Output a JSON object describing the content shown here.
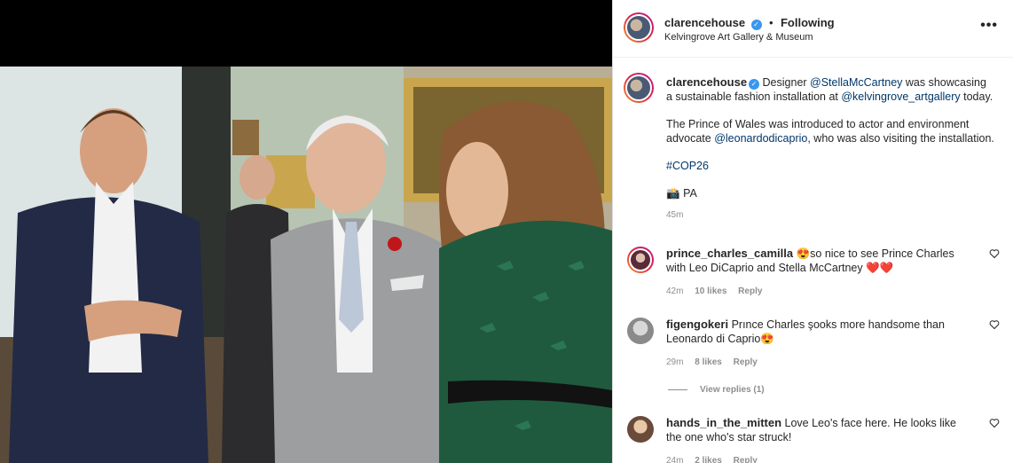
{
  "post": {
    "username": "clarencehouse",
    "verified_mark": "✓",
    "separator": "•",
    "follow_label": "Following",
    "location": "Kelvingrove Art Gallery & Museum",
    "more_icon": "•••"
  },
  "caption": {
    "username": "clarencehouse",
    "line1_pre": "Designer ",
    "mention1": "@StellaMcCartney",
    "line1_mid": " was showcasing a sustainable fashion installation at ",
    "mention2": "@kelvingrove_artgallery",
    "line1_post": " today.",
    "line2_pre": "The Prince of Wales was introduced to actor and environment advocate ",
    "mention3": "@leonardodicaprio",
    "line2_post": ", who was also visiting the installation.",
    "hashtag": "#COP26",
    "credit_icon": "📸",
    "credit": "PA",
    "time": "45m"
  },
  "comments": [
    {
      "username": "prince_charles_camilla",
      "text": "😍so nice to see Prince Charles with Leo DiCaprio and Stella McCartney ❤️❤️",
      "time": "42m",
      "likes": "10 likes",
      "reply": "Reply"
    },
    {
      "username": "figengokeri",
      "text": "Prınce Charles şooks more handsome than Leonardo di Caprio😍",
      "time": "29m",
      "likes": "8 likes",
      "reply": "Reply",
      "view_replies": "View replies (1)"
    },
    {
      "username": "hands_in_the_mitten",
      "text": "Love Leo's face here. He looks like the one who's star struck!",
      "time": "24m",
      "likes": "2 likes",
      "reply": "Reply"
    }
  ],
  "colors": {
    "accent_blue": "#3897f0",
    "mention": "#00376b",
    "muted": "#8e8e8e",
    "photo_wall": "#d9e0e0",
    "jacket_navy": "#232a45",
    "suit_grey": "#9c9ea0",
    "dress_green": "#1f5a3f"
  }
}
